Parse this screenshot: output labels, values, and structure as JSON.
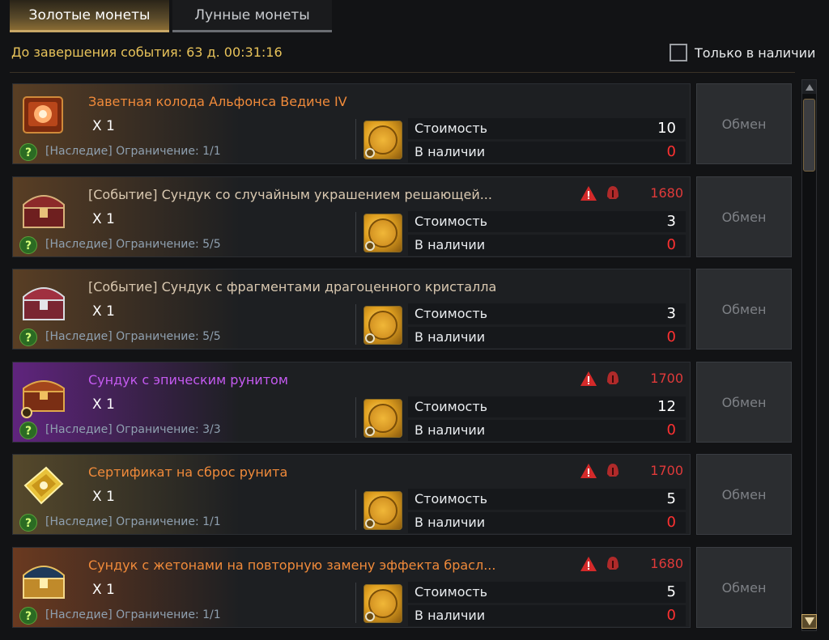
{
  "tabs": [
    {
      "label": "Золотые монеты",
      "active": true
    },
    {
      "label": "Лунные монеты",
      "active": false
    }
  ],
  "timer": "До завершения события: 63 д. 00:31:16",
  "filter": {
    "label": "Только в наличии",
    "checked": false
  },
  "labels": {
    "cost": "Стоимость",
    "available": "В наличии",
    "exchange": "Обмен"
  },
  "items": [
    {
      "name": "Заветная колода Альфонса Ведиче IV",
      "name_color": "orange",
      "quantity": "X 1",
      "limit": "[Наследие] Ограничение: 1/1",
      "cost": "10",
      "available": "0",
      "power": "",
      "icon": "book-icon"
    },
    {
      "name": "[Событие] Сундук со случайным украшением решающей...",
      "name_color": "tan",
      "quantity": "X 1",
      "limit": "[Наследие] Ограничение: 5/5",
      "cost": "3",
      "available": "0",
      "power": "1680",
      "icon": "red-chest-icon"
    },
    {
      "name": "[Событие] Сундук с фрагментами драгоценного кристалла",
      "name_color": "tan",
      "quantity": "X 1",
      "limit": "[Наследие] Ограничение: 5/5",
      "cost": "3",
      "available": "0",
      "power": "",
      "icon": "silver-chest-icon"
    },
    {
      "name": "Сундук с эпическим рунитом",
      "name_color": "purple",
      "quantity": "X 1",
      "limit": "[Наследие] Ограничение: 3/3",
      "cost": "12",
      "available": "0",
      "power": "1700",
      "icon": "epic-chest-icon"
    },
    {
      "name": "Сертификат на сброс рунита",
      "name_color": "orange",
      "quantity": "X 1",
      "limit": "[Наследие] Ограничение: 1/1",
      "cost": "5",
      "available": "0",
      "power": "1700",
      "icon": "certificate-icon"
    },
    {
      "name": "Сундук с жетонами на повторную замену эффекта брасл...",
      "name_color": "orange",
      "quantity": "X 1",
      "limit": "[Наследие] Ограничение: 1/1",
      "cost": "5",
      "available": "0",
      "power": "1680",
      "icon": "blue-chest-icon"
    }
  ]
}
